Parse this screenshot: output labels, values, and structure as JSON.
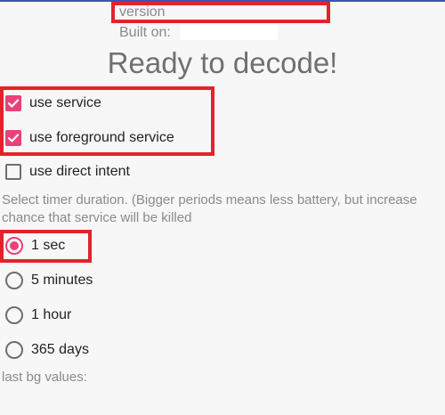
{
  "header": {
    "version_label": "version",
    "built_on_label": "Built on:",
    "headline": "Ready to decode!"
  },
  "options": {
    "use_service": {
      "label": "use service",
      "checked": true
    },
    "use_foreground_service": {
      "label": "use foreground service",
      "checked": true
    },
    "use_direct_intent": {
      "label": "use direct intent",
      "checked": false
    }
  },
  "timer": {
    "hint": "Select timer duration. (Bigger periods means less battery, but increase chance that service will be killed",
    "choices": [
      {
        "label": "1 sec",
        "selected": true
      },
      {
        "label": "5 minutes",
        "selected": false
      },
      {
        "label": "1 hour",
        "selected": false
      },
      {
        "label": "365 days",
        "selected": false
      }
    ]
  },
  "footer": {
    "last_bg_label": "last bg values:"
  },
  "colors": {
    "accent": "#ec407a",
    "highlight_box": "#e2232b",
    "unchecked": "#6e6e6e",
    "secondary_text": "#8a8a8a"
  },
  "icons": {
    "checked": "checkbox-checked-icon",
    "unchecked": "checkbox-unchecked-icon",
    "radio_on": "radio-selected-icon",
    "radio_off": "radio-unselected-icon"
  }
}
